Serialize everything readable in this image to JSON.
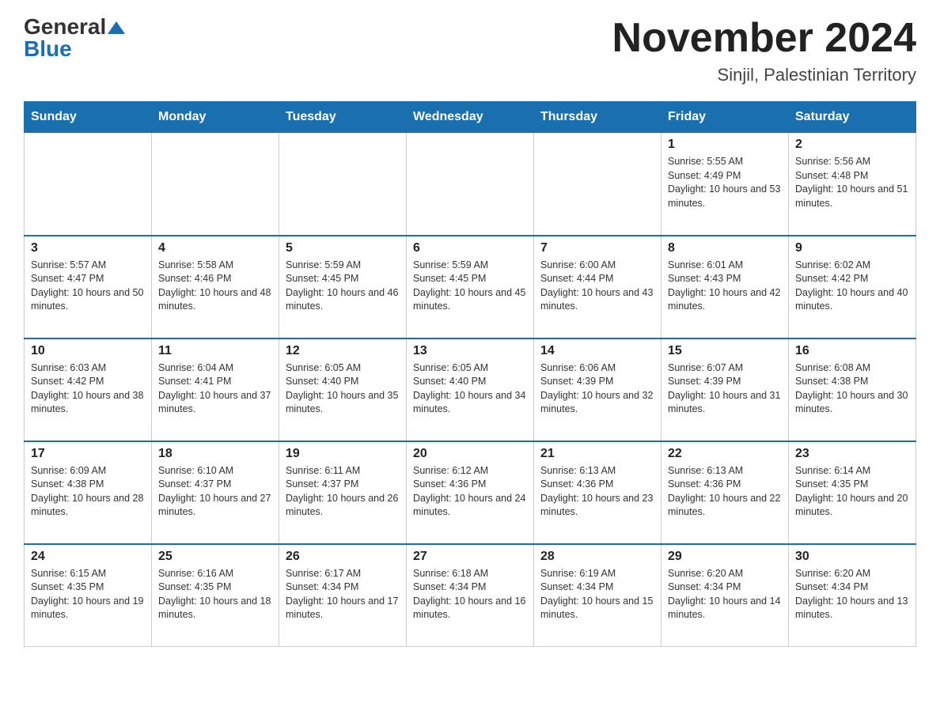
{
  "header": {
    "logo_general": "General",
    "logo_blue": "Blue",
    "month_title": "November 2024",
    "location": "Sinjil, Palestinian Territory"
  },
  "days_of_week": [
    "Sunday",
    "Monday",
    "Tuesday",
    "Wednesday",
    "Thursday",
    "Friday",
    "Saturday"
  ],
  "weeks": [
    [
      {
        "day": "",
        "info": ""
      },
      {
        "day": "",
        "info": ""
      },
      {
        "day": "",
        "info": ""
      },
      {
        "day": "",
        "info": ""
      },
      {
        "day": "",
        "info": ""
      },
      {
        "day": "1",
        "info": "Sunrise: 5:55 AM\nSunset: 4:49 PM\nDaylight: 10 hours and 53 minutes."
      },
      {
        "day": "2",
        "info": "Sunrise: 5:56 AM\nSunset: 4:48 PM\nDaylight: 10 hours and 51 minutes."
      }
    ],
    [
      {
        "day": "3",
        "info": "Sunrise: 5:57 AM\nSunset: 4:47 PM\nDaylight: 10 hours and 50 minutes."
      },
      {
        "day": "4",
        "info": "Sunrise: 5:58 AM\nSunset: 4:46 PM\nDaylight: 10 hours and 48 minutes."
      },
      {
        "day": "5",
        "info": "Sunrise: 5:59 AM\nSunset: 4:45 PM\nDaylight: 10 hours and 46 minutes."
      },
      {
        "day": "6",
        "info": "Sunrise: 5:59 AM\nSunset: 4:45 PM\nDaylight: 10 hours and 45 minutes."
      },
      {
        "day": "7",
        "info": "Sunrise: 6:00 AM\nSunset: 4:44 PM\nDaylight: 10 hours and 43 minutes."
      },
      {
        "day": "8",
        "info": "Sunrise: 6:01 AM\nSunset: 4:43 PM\nDaylight: 10 hours and 42 minutes."
      },
      {
        "day": "9",
        "info": "Sunrise: 6:02 AM\nSunset: 4:42 PM\nDaylight: 10 hours and 40 minutes."
      }
    ],
    [
      {
        "day": "10",
        "info": "Sunrise: 6:03 AM\nSunset: 4:42 PM\nDaylight: 10 hours and 38 minutes."
      },
      {
        "day": "11",
        "info": "Sunrise: 6:04 AM\nSunset: 4:41 PM\nDaylight: 10 hours and 37 minutes."
      },
      {
        "day": "12",
        "info": "Sunrise: 6:05 AM\nSunset: 4:40 PM\nDaylight: 10 hours and 35 minutes."
      },
      {
        "day": "13",
        "info": "Sunrise: 6:05 AM\nSunset: 4:40 PM\nDaylight: 10 hours and 34 minutes."
      },
      {
        "day": "14",
        "info": "Sunrise: 6:06 AM\nSunset: 4:39 PM\nDaylight: 10 hours and 32 minutes."
      },
      {
        "day": "15",
        "info": "Sunrise: 6:07 AM\nSunset: 4:39 PM\nDaylight: 10 hours and 31 minutes."
      },
      {
        "day": "16",
        "info": "Sunrise: 6:08 AM\nSunset: 4:38 PM\nDaylight: 10 hours and 30 minutes."
      }
    ],
    [
      {
        "day": "17",
        "info": "Sunrise: 6:09 AM\nSunset: 4:38 PM\nDaylight: 10 hours and 28 minutes."
      },
      {
        "day": "18",
        "info": "Sunrise: 6:10 AM\nSunset: 4:37 PM\nDaylight: 10 hours and 27 minutes."
      },
      {
        "day": "19",
        "info": "Sunrise: 6:11 AM\nSunset: 4:37 PM\nDaylight: 10 hours and 26 minutes."
      },
      {
        "day": "20",
        "info": "Sunrise: 6:12 AM\nSunset: 4:36 PM\nDaylight: 10 hours and 24 minutes."
      },
      {
        "day": "21",
        "info": "Sunrise: 6:13 AM\nSunset: 4:36 PM\nDaylight: 10 hours and 23 minutes."
      },
      {
        "day": "22",
        "info": "Sunrise: 6:13 AM\nSunset: 4:36 PM\nDaylight: 10 hours and 22 minutes."
      },
      {
        "day": "23",
        "info": "Sunrise: 6:14 AM\nSunset: 4:35 PM\nDaylight: 10 hours and 20 minutes."
      }
    ],
    [
      {
        "day": "24",
        "info": "Sunrise: 6:15 AM\nSunset: 4:35 PM\nDaylight: 10 hours and 19 minutes."
      },
      {
        "day": "25",
        "info": "Sunrise: 6:16 AM\nSunset: 4:35 PM\nDaylight: 10 hours and 18 minutes."
      },
      {
        "day": "26",
        "info": "Sunrise: 6:17 AM\nSunset: 4:34 PM\nDaylight: 10 hours and 17 minutes."
      },
      {
        "day": "27",
        "info": "Sunrise: 6:18 AM\nSunset: 4:34 PM\nDaylight: 10 hours and 16 minutes."
      },
      {
        "day": "28",
        "info": "Sunrise: 6:19 AM\nSunset: 4:34 PM\nDaylight: 10 hours and 15 minutes."
      },
      {
        "day": "29",
        "info": "Sunrise: 6:20 AM\nSunset: 4:34 PM\nDaylight: 10 hours and 14 minutes."
      },
      {
        "day": "30",
        "info": "Sunrise: 6:20 AM\nSunset: 4:34 PM\nDaylight: 10 hours and 13 minutes."
      }
    ]
  ]
}
